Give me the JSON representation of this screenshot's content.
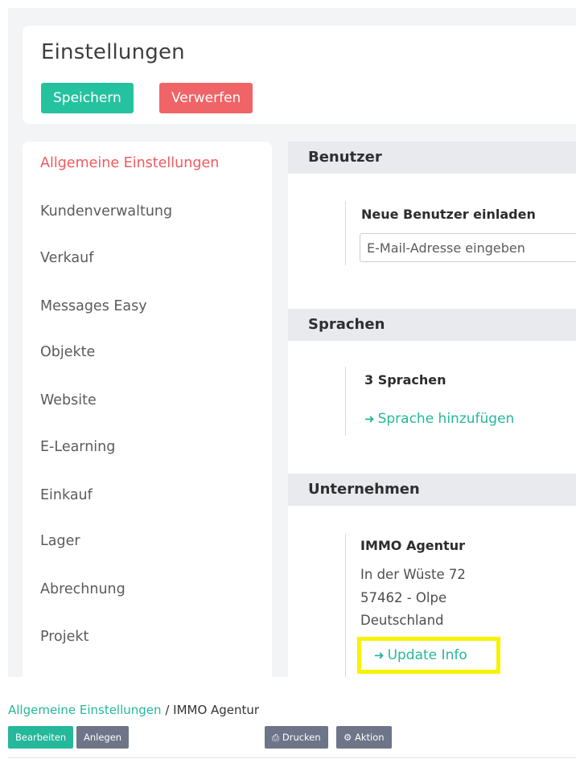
{
  "header": {
    "title": "Einstellungen",
    "save_label": "Speichern",
    "discard_label": "Verwerfen"
  },
  "sidebar": {
    "items": [
      {
        "label": "Allgemeine Einstellungen",
        "active": true
      },
      {
        "label": "Kundenverwaltung"
      },
      {
        "label": "Verkauf"
      },
      {
        "label": "Messages Easy"
      },
      {
        "label": "Objekte"
      },
      {
        "label": "Website"
      },
      {
        "label": "E-Learning"
      },
      {
        "label": "Einkauf"
      },
      {
        "label": "Lager"
      },
      {
        "label": "Abrechnung"
      },
      {
        "label": "Projekt"
      }
    ]
  },
  "sections": {
    "users": {
      "title": "Benutzer",
      "invite_label": "Neue Benutzer einladen",
      "email_placeholder": "E-Mail-Adresse eingeben"
    },
    "languages": {
      "title": "Sprachen",
      "count_label": "3 Sprachen",
      "add_link": "Sprache hinzufügen"
    },
    "company": {
      "title": "Unternehmen",
      "name": "IMMO Agentur",
      "street": "In der Wüste 72",
      "city": "57462 - Olpe",
      "country": "Deutschland",
      "update_link": "Update Info"
    }
  },
  "footer": {
    "breadcrumb_link": "Allgemeine Einstellungen",
    "breadcrumb_sep": " / ",
    "breadcrumb_current": "IMMO Agentur",
    "edit_label": "Bearbeiten",
    "create_label": "Anlegen",
    "print_label": "Drucken",
    "action_label": "Aktion"
  },
  "colors": {
    "accent_teal": "#25c2a0",
    "danger_red": "#f06467",
    "highlight_yellow": "#f6f200"
  },
  "icons": {
    "link_arrow": "arrow-right-icon",
    "print": "printer-icon",
    "action": "gear-icon"
  }
}
